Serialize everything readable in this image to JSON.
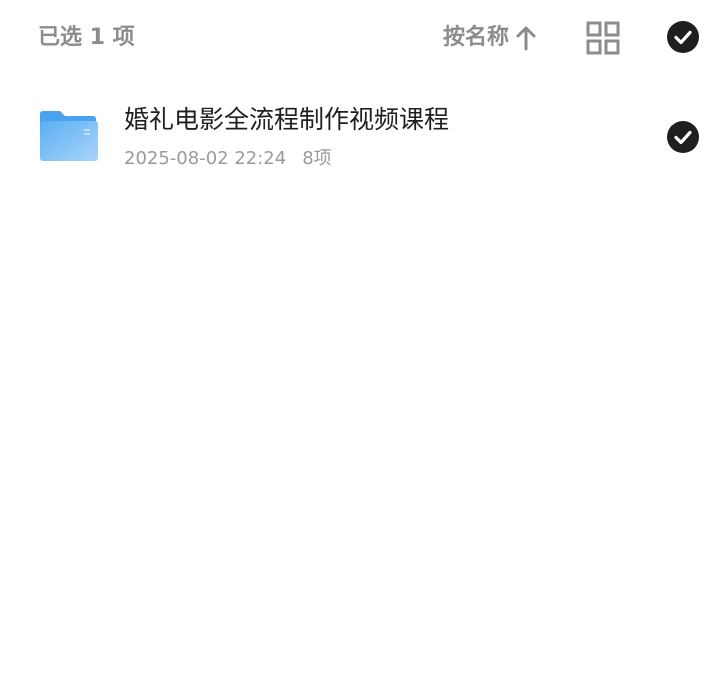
{
  "header": {
    "selected_count": "已选 1 项",
    "sort_label": "按名称",
    "sort_direction_icon": "arrow-up-icon",
    "view_toggle_icon": "grid-view-icon",
    "select_all_icon": "check-circle-icon"
  },
  "files": [
    {
      "name": "婚礼电影全流程制作视频课程",
      "date": "2025-08-02 22:24",
      "item_count": "8项",
      "type_icon": "folder-icon",
      "selected": true
    }
  ],
  "colors": {
    "muted_text": "#8c8c8c",
    "primary_text": "#1f1f1f",
    "meta_text": "#9a9a9a",
    "check_fill": "#1f1f1f",
    "folder_blue": "#5aaef2",
    "folder_blue_light": "#a9d5fa"
  }
}
